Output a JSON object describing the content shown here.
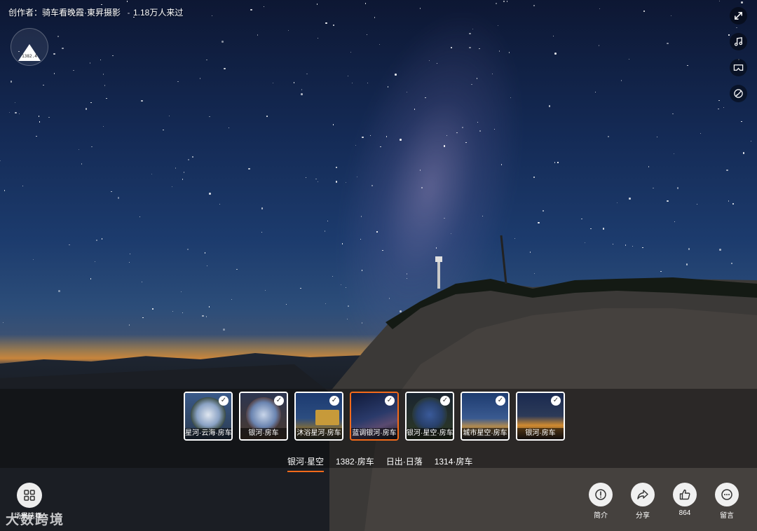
{
  "header": {
    "author": "创作者：骑车看晚霞·東昇摄影",
    "visits": "1.18万人来过"
  },
  "logo": {
    "code": "1382.4"
  },
  "tools": [
    {
      "name": "fullscreen-icon"
    },
    {
      "name": "music-icon"
    },
    {
      "name": "vr-icon"
    },
    {
      "name": "gyroscope-icon"
    }
  ],
  "scenes": [
    {
      "label": "星河·云海·房车",
      "active": false
    },
    {
      "label": "银河·房车",
      "active": false
    },
    {
      "label": "沐浴星河·房车",
      "active": false
    },
    {
      "label": "蓝调银河·房车",
      "active": true
    },
    {
      "label": "银河·星空·房车",
      "active": false
    },
    {
      "label": "城市星空·房车",
      "active": false
    },
    {
      "label": "银河·房车",
      "active": false
    }
  ],
  "tabs": [
    {
      "label": "银河·星空",
      "active": true
    },
    {
      "label": "1382·房车",
      "active": false
    },
    {
      "label": "日出·日落",
      "active": false
    },
    {
      "label": "1314·房车",
      "active": false
    }
  ],
  "scene_select": {
    "label": "场景选择"
  },
  "watermark": "大数跨境",
  "actions": {
    "intro": "简介",
    "share": "分享",
    "likes": "864",
    "comment": "留言"
  }
}
